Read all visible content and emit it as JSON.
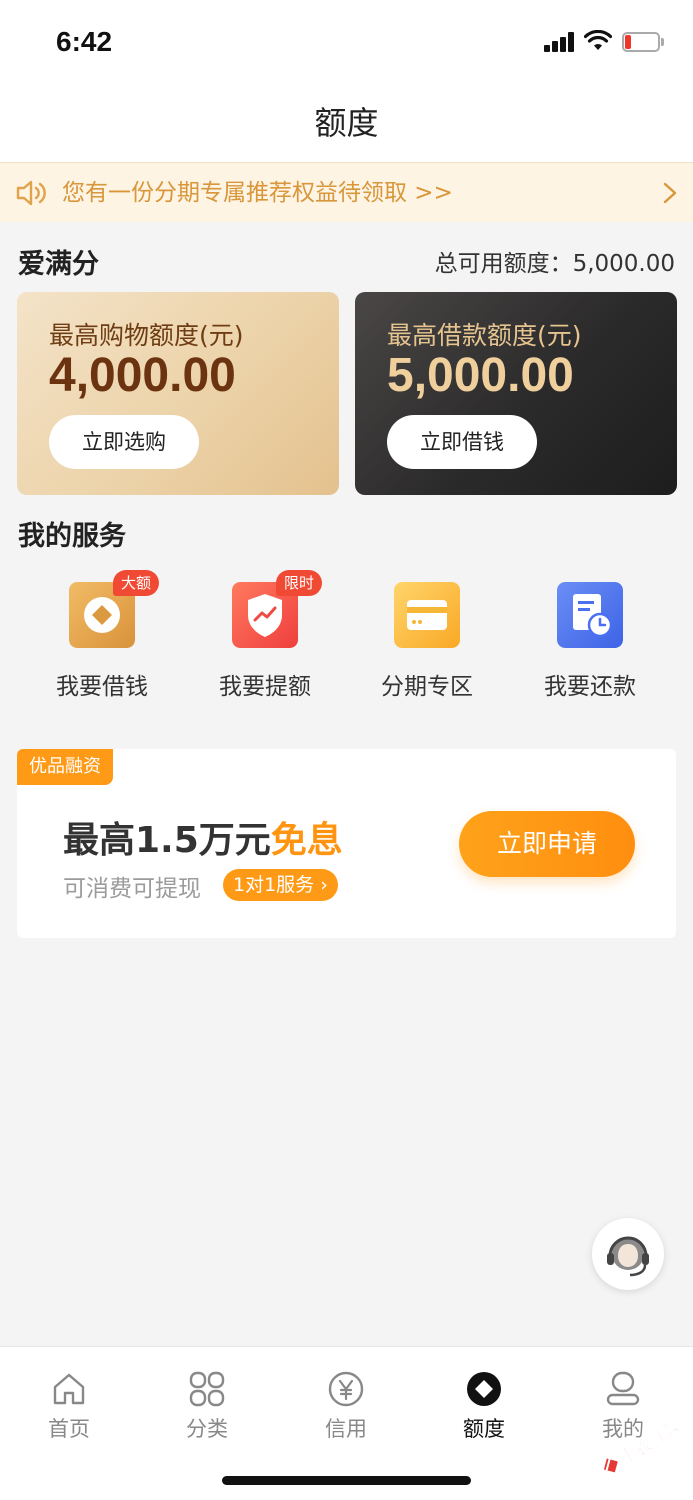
{
  "status_bar": {
    "time": "6:42"
  },
  "nav": {
    "title": "额度"
  },
  "notice": {
    "text": "您有一份分期专属推荐权益待领取 >>"
  },
  "credit": {
    "section_title": "爱满分",
    "total_available": "总可用额度：5,000.00"
  },
  "cards": {
    "shopping": {
      "label": "最高购物额度(元)",
      "amount": "4,000.00",
      "button": "立即选购"
    },
    "loan": {
      "label": "最高借款额度(元)",
      "amount": "5,000.00",
      "button": "立即借钱"
    }
  },
  "services": {
    "title": "我的服务",
    "items": [
      {
        "label": "我要借钱",
        "tag": "大额",
        "icon": "coin-icon"
      },
      {
        "label": "我要提额",
        "tag": "限时",
        "icon": "shield-trend-icon"
      },
      {
        "label": "分期专区",
        "tag": "",
        "icon": "card-icon"
      },
      {
        "label": "我要还款",
        "tag": "",
        "icon": "bill-clock-icon"
      }
    ]
  },
  "promo": {
    "badge": "优品融资",
    "headline_prefix": "最高1.5万元",
    "headline_highlight": "免息",
    "subtitle": "可消费可提现",
    "pill": "1对1服务 ›",
    "apply_button": "立即申请"
  },
  "tabbar": {
    "items": [
      {
        "label": "首页",
        "icon": "home-icon",
        "active": false
      },
      {
        "label": "分类",
        "icon": "grid-icon",
        "active": false
      },
      {
        "label": "信用",
        "icon": "yen-icon",
        "active": false
      },
      {
        "label": "额度",
        "icon": "diamond-icon",
        "active": true
      },
      {
        "label": "我的",
        "icon": "user-icon",
        "active": false
      }
    ]
  },
  "colors": {
    "accent": "#ff9a17",
    "notice_text": "#d9963a",
    "tag_red": "#f04a34"
  },
  "watermark": {
    "text": "卡农社区"
  }
}
